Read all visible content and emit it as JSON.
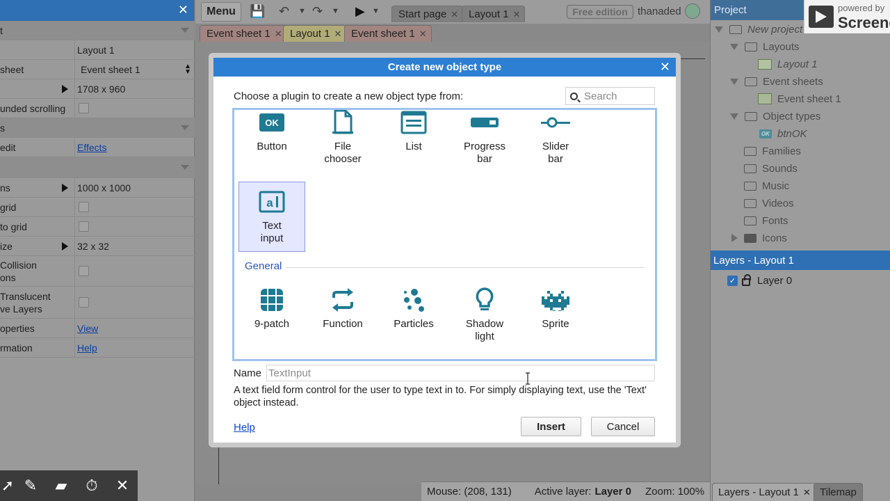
{
  "properties_panel": {
    "rows": [
      {
        "key": "t",
        "value": ""
      },
      {
        "key": "",
        "value": "Layout 1"
      },
      {
        "key": "sheet",
        "value": "Event sheet 1"
      },
      {
        "key": "",
        "value": "1708 x 960"
      },
      {
        "key": "unded scrolling",
        "value": ""
      },
      {
        "key": "s",
        "value": ""
      },
      {
        "key": "edit",
        "value": "Effects"
      },
      {
        "key": "",
        "value": ""
      },
      {
        "key": "ns",
        "value": "1000 x 1000"
      },
      {
        "key": "grid",
        "value": ""
      },
      {
        "key": "to grid",
        "value": ""
      },
      {
        "key": "ize",
        "value": "32 x 32"
      },
      {
        "key": "Collision\nons",
        "value": ""
      },
      {
        "key": "Translucent\nve Layers",
        "value": ""
      },
      {
        "key": "operties",
        "value": "View"
      },
      {
        "key": "rmation",
        "value": "Help"
      }
    ]
  },
  "toolbar": {
    "menu_label": "Menu",
    "top_tabs": [
      "Start page",
      "Layout 1"
    ],
    "edition_badge": "Free edition",
    "username": "thanaded"
  },
  "editor_tabs": [
    "Event sheet 1",
    "Layout 1",
    "Event sheet 1"
  ],
  "status_bar": {
    "mouse": "Mouse: (208, 131)",
    "active_layer_label": "Active layer:",
    "active_layer_value": "Layer 0",
    "zoom": "Zoom: 100%"
  },
  "project_panel": {
    "title": "Project",
    "items": [
      {
        "label": "New project",
        "depth": 0,
        "kind": "folder",
        "italic": true,
        "expanded": true
      },
      {
        "label": "Layouts",
        "depth": 1,
        "kind": "folder",
        "expanded": true
      },
      {
        "label": "Layout 1",
        "depth": 2,
        "kind": "layout",
        "italic": true
      },
      {
        "label": "Event sheets",
        "depth": 1,
        "kind": "folder",
        "expanded": true
      },
      {
        "label": "Event sheet 1",
        "depth": 2,
        "kind": "sheet"
      },
      {
        "label": "Object types",
        "depth": 1,
        "kind": "folder",
        "expanded": true
      },
      {
        "label": "btnOK",
        "depth": 2,
        "kind": "ok",
        "italic": true
      },
      {
        "label": "Families",
        "depth": 1,
        "kind": "folder"
      },
      {
        "label": "Sounds",
        "depth": 1,
        "kind": "folder"
      },
      {
        "label": "Music",
        "depth": 1,
        "kind": "folder"
      },
      {
        "label": "Videos",
        "depth": 1,
        "kind": "folder"
      },
      {
        "label": "Fonts",
        "depth": 1,
        "kind": "folder"
      },
      {
        "label": "Icons",
        "depth": 1,
        "kind": "folder-filled",
        "collapsed": true
      }
    ]
  },
  "layers_panel": {
    "title": "Layers - Layout 1",
    "layers": [
      {
        "name": "Layer 0",
        "visible": true,
        "locked": true
      }
    ]
  },
  "bottom_tabs": [
    "Layers - Layout 1",
    "Tilemap"
  ],
  "watermark": {
    "line1": "powered by",
    "line2": "Screenc"
  },
  "dialog": {
    "title": "Create new object type",
    "prompt": "Choose a plugin to create a new object type from:",
    "search_placeholder": "Search",
    "plugins_form": [
      {
        "label": "Button",
        "icon": "button-icon"
      },
      {
        "label": "File chooser",
        "icon": "file-icon"
      },
      {
        "label": "List",
        "icon": "list-icon"
      },
      {
        "label": "Progress bar",
        "icon": "progress-bar-icon"
      },
      {
        "label": "Slider bar",
        "icon": "slider-icon"
      },
      {
        "label": "Text input",
        "icon": "text-input-icon",
        "selected": true
      }
    ],
    "section_general": "General",
    "plugins_general": [
      {
        "label": "9-patch",
        "icon": "nine-patch-icon"
      },
      {
        "label": "Function",
        "icon": "function-icon"
      },
      {
        "label": "Particles",
        "icon": "particles-icon"
      },
      {
        "label": "Shadow light",
        "icon": "shadow-light-icon"
      },
      {
        "label": "Sprite",
        "icon": "sprite-icon"
      }
    ],
    "name_label": "Name",
    "name_value": "TextInput",
    "description": "A text field form control for the user to type text in to. For simply displaying text, use the 'Text' object instead.",
    "help_link": "Help",
    "insert_button": "Insert",
    "cancel_button": "Cancel"
  },
  "colors": {
    "accent": "#2d7fd4",
    "icon_teal": "#1e7a93",
    "selection": "#e3e7ff"
  }
}
